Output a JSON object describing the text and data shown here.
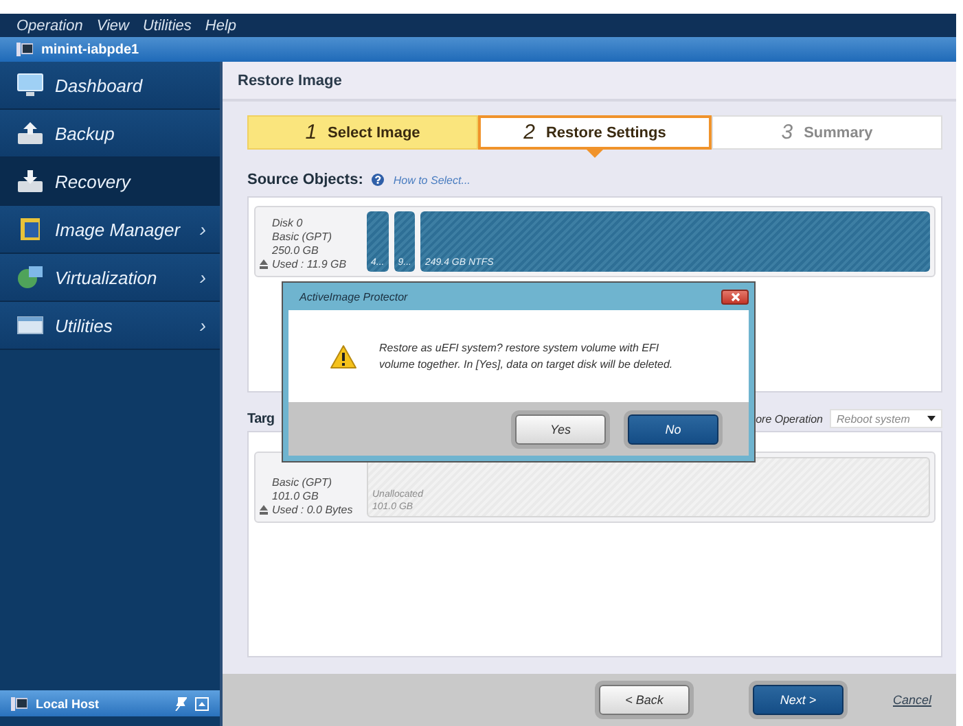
{
  "menu_bar": [
    "Operation",
    "View",
    "Utilities",
    "Help"
  ],
  "host_bar": {
    "title": "minint-iabpde1"
  },
  "sidebar": {
    "items": [
      {
        "label": "Dashboard",
        "selected": false
      },
      {
        "label": "Backup",
        "selected": false
      },
      {
        "label": "Recovery",
        "selected": true
      },
      {
        "label": "Image Manager",
        "selected": false,
        "arrow": "›"
      },
      {
        "label": "Virtualization",
        "selected": false,
        "arrow": "›"
      },
      {
        "label": "Utilities",
        "selected": false,
        "arrow": "›"
      }
    ],
    "footer": {
      "label": "Local Host"
    }
  },
  "page_title": "Restore Image",
  "steps": [
    {
      "number": "1",
      "label": "Select Image",
      "completed": true,
      "selected": false
    },
    {
      "number": "2",
      "label": "Restore Settings",
      "completed": false,
      "selected": true
    },
    {
      "number": "3",
      "label": "Summary",
      "completed": false,
      "selected": false
    }
  ],
  "source": {
    "heading": "Source Objects:",
    "help_link": "How to Select...",
    "disk": {
      "lines": [
        "Disk 0",
        "Basic (GPT)",
        "250.0 GB",
        "Used : 11.9 GB"
      ],
      "partitions": [
        {
          "lines": [
            "4..."
          ],
          "kind": "used"
        },
        {
          "lines": [
            "9..."
          ],
          "kind": "used"
        },
        {
          "lines": [
            "249.4 GB NTFS"
          ],
          "kind": "used"
        }
      ]
    }
  },
  "target": {
    "heading": "Targ",
    "operation_label": "ore Operation",
    "operation_value": "Reboot system",
    "disk": {
      "lines": [
        "Basic (GPT)",
        "101.0 GB",
        "Used : 0.0 Bytes"
      ],
      "partitions": [
        {
          "lines": [
            "Unallocated",
            "101.0 GB"
          ],
          "kind": "unallocated"
        }
      ]
    }
  },
  "dialog": {
    "title": "ActiveImage Protector",
    "message": "Restore as uEFI system? restore system volume with EFI volume together. In [Yes], data on target disk will be deleted.",
    "buttons": [
      {
        "label": "Yes",
        "focused": false
      },
      {
        "label": "No",
        "focused": true
      }
    ]
  },
  "footer": {
    "buttons": [
      {
        "label": "< Back",
        "kind": "secondary"
      },
      {
        "label": "Next >",
        "kind": "primary"
      }
    ],
    "cancel": "Cancel"
  }
}
